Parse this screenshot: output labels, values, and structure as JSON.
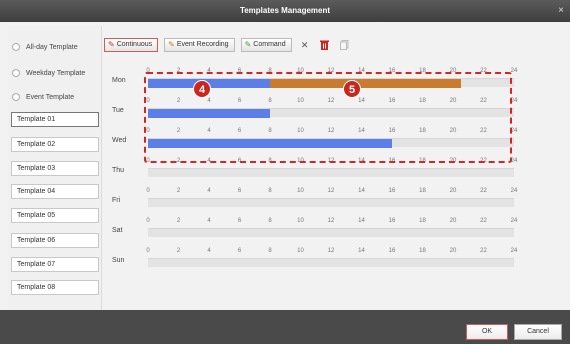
{
  "window": {
    "title": "Templates Management",
    "close_glyph": "×"
  },
  "sidebar": {
    "radios": [
      {
        "label": "All-day Template"
      },
      {
        "label": "Weekday Template"
      },
      {
        "label": "Event Template"
      }
    ],
    "templates": [
      {
        "label": "Template 01",
        "active": true
      },
      {
        "label": "Template 02"
      },
      {
        "label": "Template 03"
      },
      {
        "label": "Template 04"
      },
      {
        "label": "Template 05"
      },
      {
        "label": "Template 06"
      },
      {
        "label": "Template 07"
      },
      {
        "label": "Template 08"
      }
    ]
  },
  "toolbar": {
    "continuous_label": "Continuous",
    "event_label": "Event Recording",
    "command_label": "Command",
    "delete_glyph": "✕",
    "icons": [
      "pencil-icon",
      "delete-icon",
      "trash-icon",
      "copy-icon"
    ]
  },
  "schedule": {
    "ticks": [
      "0",
      "2",
      "4",
      "6",
      "8",
      "10",
      "12",
      "14",
      "16",
      "18",
      "20",
      "22",
      "24"
    ],
    "colors": {
      "continuous": "#5b7fe6",
      "event": "#c97b2e",
      "track": "#e3e3e3"
    },
    "days": [
      {
        "label": "Mon",
        "segments": [
          {
            "start": 0,
            "end": 8,
            "type": "continuous"
          },
          {
            "start": 8,
            "end": 20.5,
            "type": "event"
          }
        ]
      },
      {
        "label": "Tue",
        "segments": [
          {
            "start": 0,
            "end": 8,
            "type": "continuous"
          }
        ]
      },
      {
        "label": "Wed",
        "segments": [
          {
            "start": 0,
            "end": 16,
            "type": "continuous"
          }
        ]
      },
      {
        "label": "Thu",
        "segments": []
      },
      {
        "label": "Fri",
        "segments": []
      },
      {
        "label": "Sat",
        "segments": []
      },
      {
        "label": "Sun",
        "segments": []
      }
    ]
  },
  "callouts": [
    {
      "number": "4"
    },
    {
      "number": "5"
    }
  ],
  "footer": {
    "ok_label": "OK",
    "cancel_label": "Cancel"
  }
}
